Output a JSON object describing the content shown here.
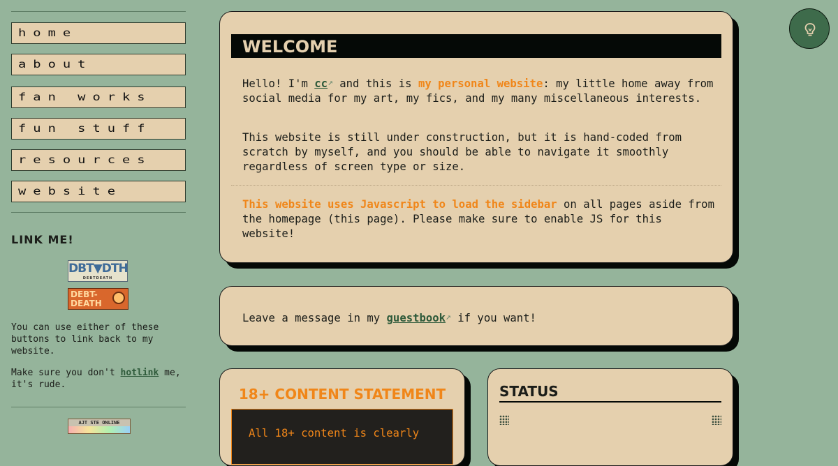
{
  "sidebar": {
    "nav": [
      "home",
      "about",
      "fan works",
      "fun stuff",
      "resources",
      "website"
    ],
    "link_me_heading": "LINK ME!",
    "badge1": {
      "text": "DBT▼DTH",
      "sub": "DEBTDEATH"
    },
    "badge2": {
      "line1": "DEBT-",
      "line2": "DEATH"
    },
    "link_back_text": "You can use either of these buttons to link back to my website.",
    "hotlink_before": "Make sure you don't ",
    "hotlink_link": "hotlink",
    "hotlink_after": " me, it's rude.",
    "badge3": {
      "text": "AJT STE ONLINE"
    }
  },
  "welcome": {
    "title": "WELCOME",
    "p1_a": "Hello! I'm ",
    "p1_link": "cc",
    "p1_b": " and this is ",
    "p1_hl": "my personal website",
    "p1_c": ": my little home away from social media for my art, my fics, and my many miscellaneous interests.",
    "p2": "This website is still under construction, but it is hand-coded from scratch by myself, and you should be able to navigate it smoothly regardless of screen type or size.",
    "p3_hl": "This website uses Javascript to load the sidebar",
    "p3_rest": " on all pages aside from the homepage (this page). Please make sure to enable JS for this website!"
  },
  "guestbook": {
    "before": "Leave a message in my ",
    "link": "guestbook",
    "after": " if you want!"
  },
  "statement": {
    "title": "18+ CONTENT STATEMENT",
    "body": "All 18+ content is clearly"
  },
  "status": {
    "title": "STATUS"
  },
  "icons": {
    "external": "external-link-icon",
    "theme": "lightbulb-icon"
  },
  "colors": {
    "background": "#95b49b",
    "card": "#e5d0ae",
    "accent": "#f08619",
    "link": "#2e5a3a",
    "dark": "#050906"
  }
}
